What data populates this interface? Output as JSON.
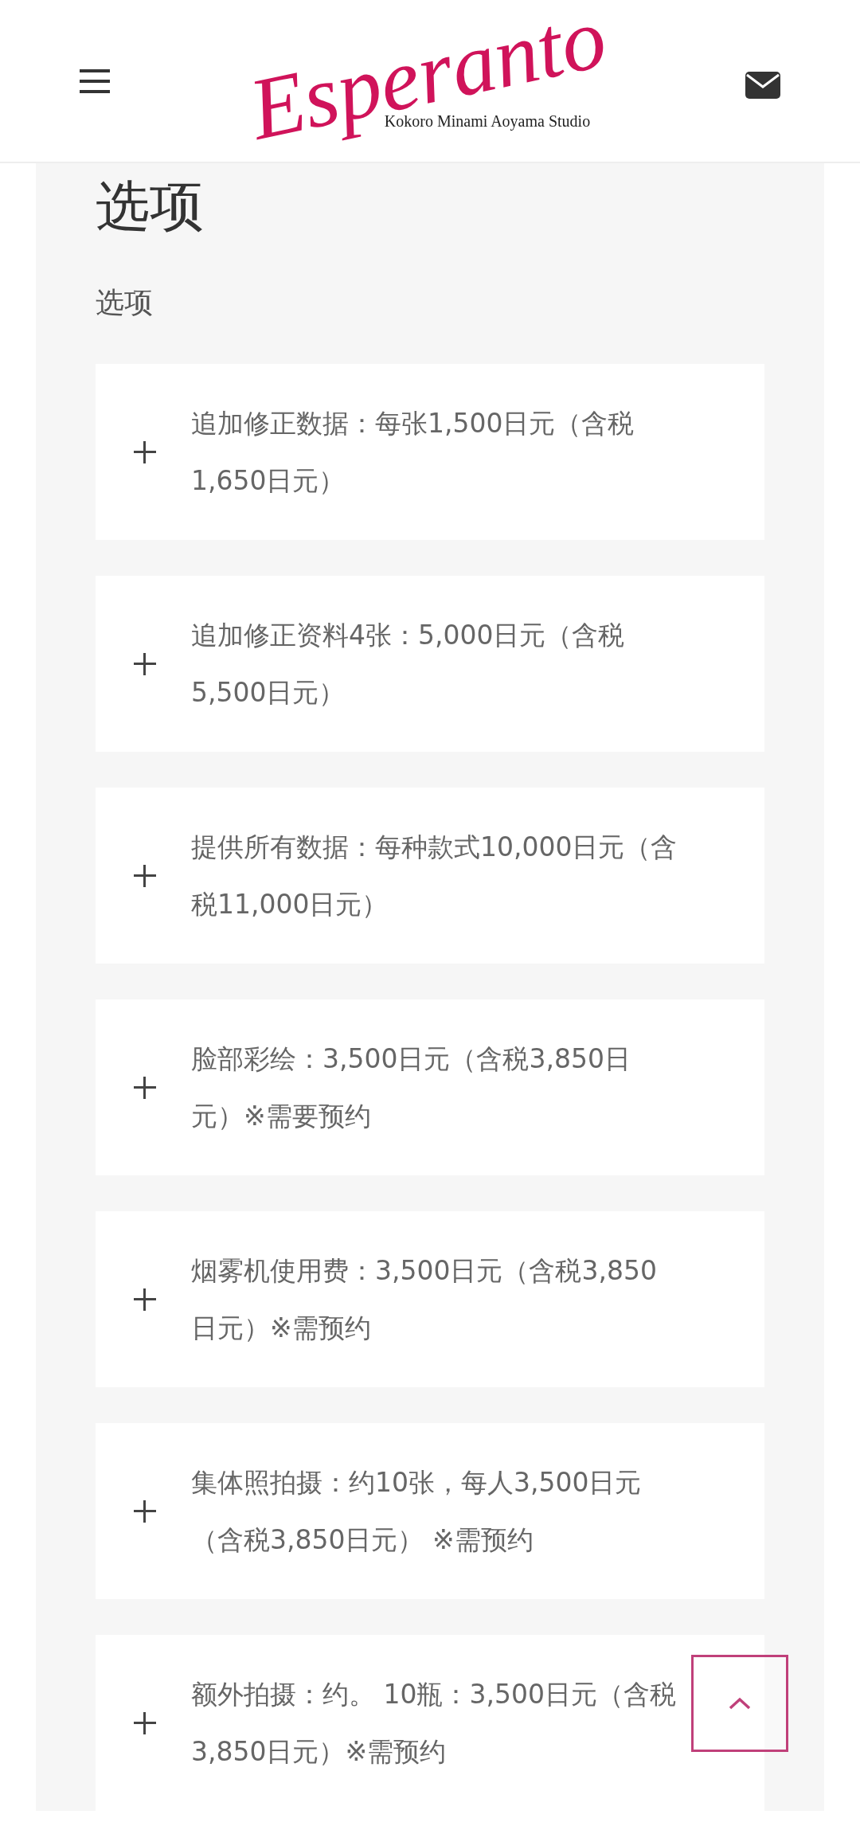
{
  "header": {
    "logo": "Esperanto",
    "logo_subtitle": "Kokoro Minami Aoyama Studio"
  },
  "heading": "选项",
  "subheading": "选项",
  "options": [
    {
      "text": "追加修正数据：每张1,500日元（含税1,650日元）",
      "expanded": false
    },
    {
      "text": "追加修正资料4张：5,000日元（含税5,500日元）",
      "expanded": false
    },
    {
      "text": "提供所有数据：每种款式10,000日元（含税11,000日元）",
      "expanded": false
    },
    {
      "text": "脸部彩绘：3,500日元（含税3,850日元）※需要预约",
      "expanded": false
    },
    {
      "text": "烟雾机使用费：3,500日元（含税3,850日元）※需预约",
      "expanded": false
    },
    {
      "text": "集体照拍摄：约10张，每人3,500日元（含税3,850日元） ※需预约",
      "expanded": false
    },
    {
      "text": "额外拍摄：约。 10瓶：3,500日元（含税3,850日元）※需预约",
      "expanded": false
    }
  ]
}
